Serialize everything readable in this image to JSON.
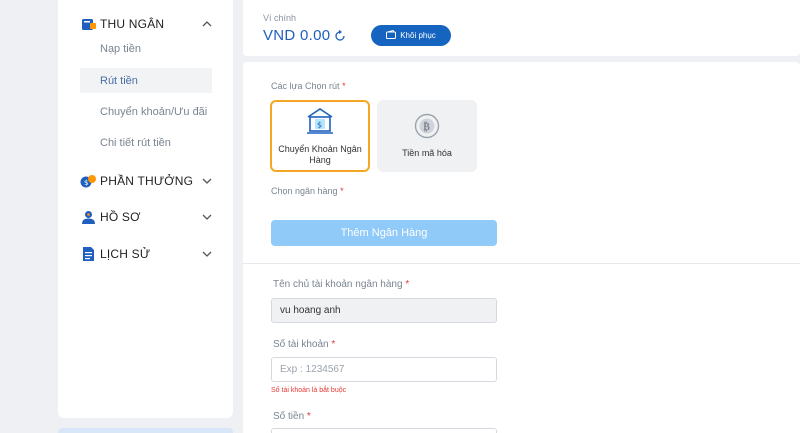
{
  "sidebar": {
    "sections": [
      {
        "label": "THU NGÂN"
      },
      {
        "label": "PHẦN THƯỞNG"
      },
      {
        "label": "HỒ SƠ"
      },
      {
        "label": "LỊCH SỬ"
      }
    ],
    "cashier_items": [
      {
        "label": "Nạp tiền"
      },
      {
        "label": "Rút tiền"
      },
      {
        "label": "Chuyển khoản/Ưu đãi"
      },
      {
        "label": "Chi tiết rút tiền"
      }
    ]
  },
  "wallet": {
    "label": "Ví chính",
    "balance": "VND 0.00",
    "restore_label": "Khôi phục"
  },
  "withdraw": {
    "method_label": "Các lựa Chọn rút",
    "options": [
      {
        "label": "Chuyển Khoản Ngân Hàng",
        "selected": true
      },
      {
        "label": "Tiền mã hóa",
        "selected": false
      }
    ],
    "bank_label": "Chọn ngân hàng",
    "add_bank_label": "Thêm Ngân Hàng",
    "account_name_label": "Tên chủ tài khoản ngân hàng",
    "account_name_value": "vu hoang anh",
    "account_number_label": "Số tài khoản",
    "account_number_placeholder": "Exp : 1234567",
    "account_number_error": "Số tài khoản là bắt buộc",
    "amount_label": "Số tiền",
    "required_mark": "*"
  },
  "colors": {
    "accent": "#1565c0",
    "balance": "#1f5fbf",
    "selected_border": "#f5a623",
    "add_bank": "#90caf9",
    "error": "#e53935"
  }
}
